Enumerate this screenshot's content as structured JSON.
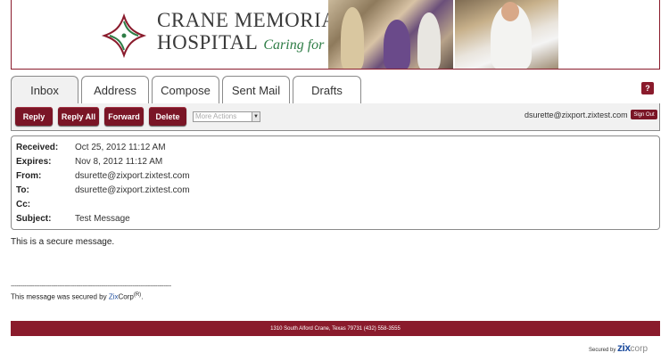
{
  "banner": {
    "name_line1": "Crane Memorial",
    "name_line2": "Hospital",
    "tagline": "Caring for others",
    "brand_color": "#8a1b2c",
    "tagline_color": "#2e7d46"
  },
  "tabs": [
    {
      "label": "Inbox",
      "active": true
    },
    {
      "label": "Address",
      "active": false
    },
    {
      "label": "Compose",
      "active": false
    },
    {
      "label": "Sent Mail",
      "active": false
    },
    {
      "label": "Drafts",
      "active": false
    }
  ],
  "help": {
    "label": "?"
  },
  "toolbar": {
    "reply": "Reply",
    "reply_all": "Reply All",
    "forward": "Forward",
    "delete": "Delete",
    "more_actions": "More Actions",
    "user_email": "dsurette@zixport.zixtest.com",
    "sign_out": "Sign Out"
  },
  "message": {
    "received_label": "Received:",
    "received": "Oct 25, 2012 11:12 AM",
    "expires_label": "Expires:",
    "expires": "Nov 8, 2012 11:12 AM",
    "from_label": "From:",
    "from": "dsurette@zixport.zixtest.com",
    "to_label": "To:",
    "to": "dsurette@zixport.zixtest.com",
    "cc_label": "Cc:",
    "cc": "",
    "subject_label": "Subject:",
    "subject": "Test Message",
    "body": "This is a secure message."
  },
  "security_note": {
    "separator": "-----------------------------------------------------------------------------------",
    "prefix": "This message was secured by ",
    "zix": "Zix",
    "corp": "Corp",
    "reg": "(R)",
    "suffix": "."
  },
  "footer": {
    "address": "1310 South Alford Crane, Texas 79731 (432) 558-3555"
  },
  "secured_by": {
    "prefix": "Secured by",
    "zix": "zix",
    "corp": "corp"
  }
}
